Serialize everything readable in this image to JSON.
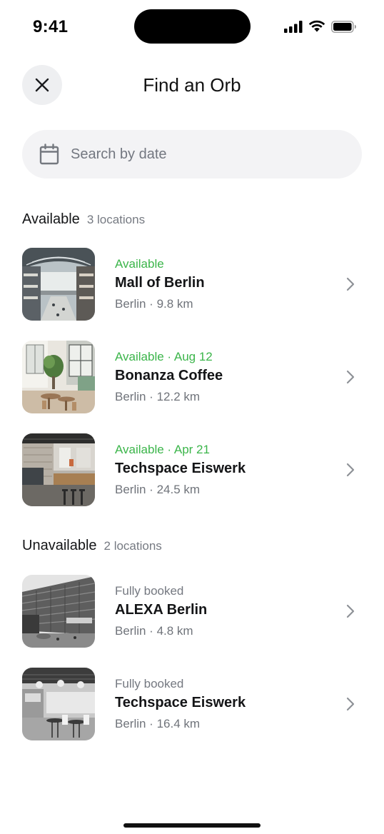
{
  "status_bar": {
    "time": "9:41"
  },
  "header": {
    "title": "Find an Orb",
    "close_icon": "close-icon"
  },
  "search": {
    "placeholder": "Search by date",
    "icon": "calendar-icon"
  },
  "sections": [
    {
      "title": "Available",
      "count": "3 locations",
      "items": [
        {
          "status": "Available",
          "name": "Mall of Berlin",
          "meta": "Berlin · 9.8 km",
          "status_type": "available"
        },
        {
          "status": "Available · Aug 12",
          "name": "Bonanza Coffee",
          "meta": "Berlin · 12.2 km",
          "status_type": "available"
        },
        {
          "status": "Available · Apr 21",
          "name": "Techspace Eiswerk",
          "meta": "Berlin · 24.5 km",
          "status_type": "available"
        }
      ]
    },
    {
      "title": "Unavailable",
      "count": "2 locations",
      "items": [
        {
          "status": "Fully booked",
          "name": "ALEXA Berlin",
          "meta": "Berlin · 4.8 km",
          "status_type": "booked"
        },
        {
          "status": "Fully booked",
          "name": "Techspace Eiswerk",
          "meta": "Berlin · 16.4 km",
          "status_type": "booked"
        }
      ]
    }
  ],
  "colors": {
    "available": "#3bb54a",
    "booked": "#747880",
    "search_bg": "#f3f3f5",
    "close_bg": "#eeeff1"
  }
}
